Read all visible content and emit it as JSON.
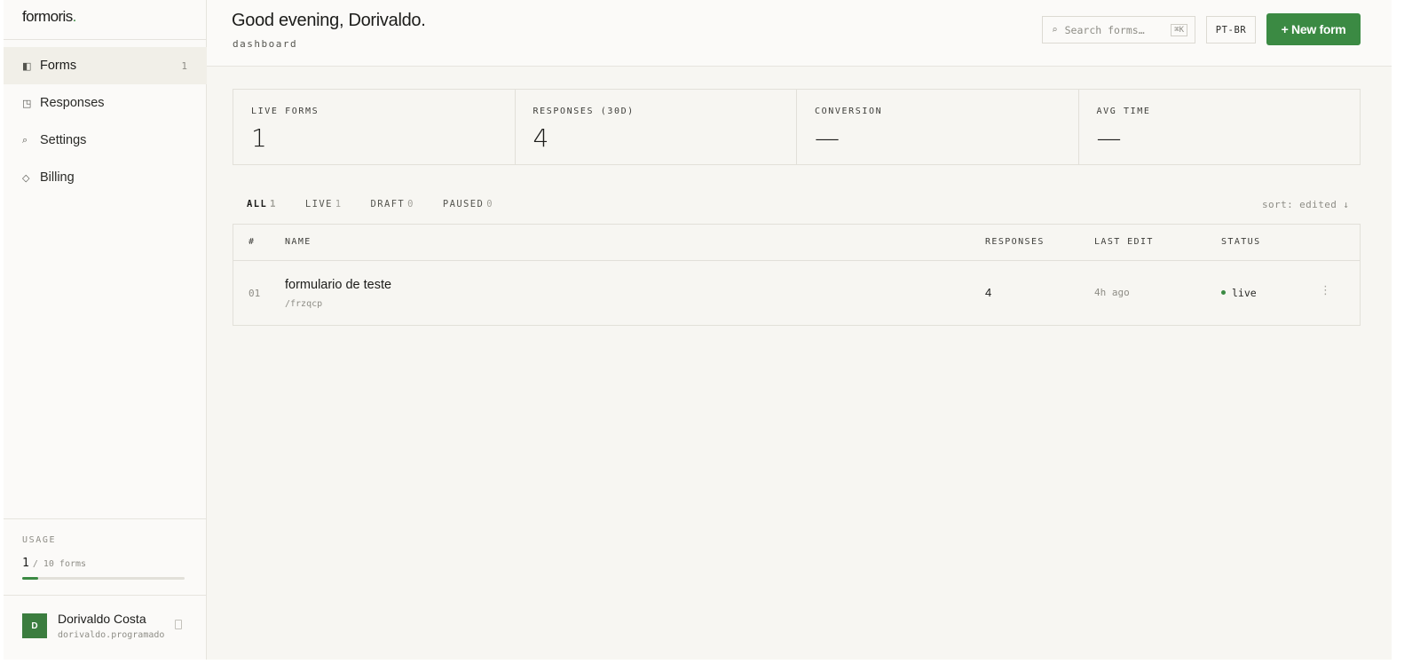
{
  "sidebar": {
    "logo": "formoris",
    "logo_dot": ".",
    "nav": [
      {
        "icon": "forms-icon",
        "glyph": "◧",
        "label": "Forms",
        "count": "1",
        "active": true
      },
      {
        "icon": "responses-icon",
        "glyph": "◳",
        "label": "Responses",
        "count": ""
      },
      {
        "icon": "settings-icon",
        "glyph": "⌕",
        "label": "Settings",
        "count": ""
      },
      {
        "icon": "billing-icon",
        "glyph": "◇",
        "label": "Billing",
        "count": ""
      }
    ],
    "usage": {
      "label": "USAGE",
      "used": "1",
      "of": "/ 10 forms",
      "fraction": 0.1
    },
    "user": {
      "initial": "D",
      "name": "Dorivaldo Costa",
      "email": "dorivaldo.programador"
    }
  },
  "header": {
    "greeting": "Good evening, Dorivaldo.",
    "subtitle": "dashboard",
    "search_placeholder": "Search forms…",
    "search_shortcut": "⌘K",
    "lang": "PT-BR",
    "new_button": "+ New form"
  },
  "stats": [
    {
      "label": "LIVE FORMS",
      "value": "1"
    },
    {
      "label": "RESPONSES (30D)",
      "value": "4"
    },
    {
      "label": "CONVERSION",
      "value": "—"
    },
    {
      "label": "AVG TIME",
      "value": "—"
    }
  ],
  "tabs": [
    {
      "label": "ALL",
      "count": "1",
      "active": true
    },
    {
      "label": "LIVE",
      "count": "1"
    },
    {
      "label": "DRAFT",
      "count": "0"
    },
    {
      "label": "PAUSED",
      "count": "0"
    }
  ],
  "sort": "sort: edited ↓",
  "table": {
    "columns": {
      "num": "#",
      "name": "NAME",
      "responses": "RESPONSES",
      "last_edit": "LAST EDIT",
      "status": "STATUS"
    },
    "rows": [
      {
        "num": "01",
        "name": "formulario de teste",
        "slug": "/frzqcp",
        "responses": "4",
        "last_edit": "4h ago",
        "status": "live",
        "more": "⋮"
      }
    ]
  },
  "colors": {
    "accent": "#3b8a43",
    "background": "#f7f6f2",
    "sidebar": "#fbfaf8"
  }
}
